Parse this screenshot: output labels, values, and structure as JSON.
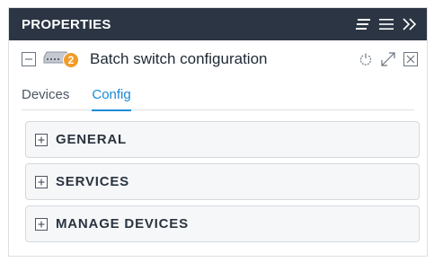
{
  "panel": {
    "title": "PROPERTIES",
    "header_icons": [
      "sort-lines-icon",
      "hamburger-menu-icon",
      "double-chevron-right-icon"
    ]
  },
  "device": {
    "badge_count": "2",
    "name": "Batch switch configuration",
    "icons": [
      "power-icon",
      "expand-icon",
      "close-icon"
    ]
  },
  "tabs": [
    {
      "label": "Devices",
      "active": false
    },
    {
      "label": "Config",
      "active": true
    }
  ],
  "sections": [
    {
      "label": "GENERAL"
    },
    {
      "label": "SERVICES"
    },
    {
      "label": "MANAGE DEVICES"
    }
  ],
  "colors": {
    "header_bg": "#2b3544",
    "accent": "#1a8bd6",
    "badge": "#f29b27"
  }
}
